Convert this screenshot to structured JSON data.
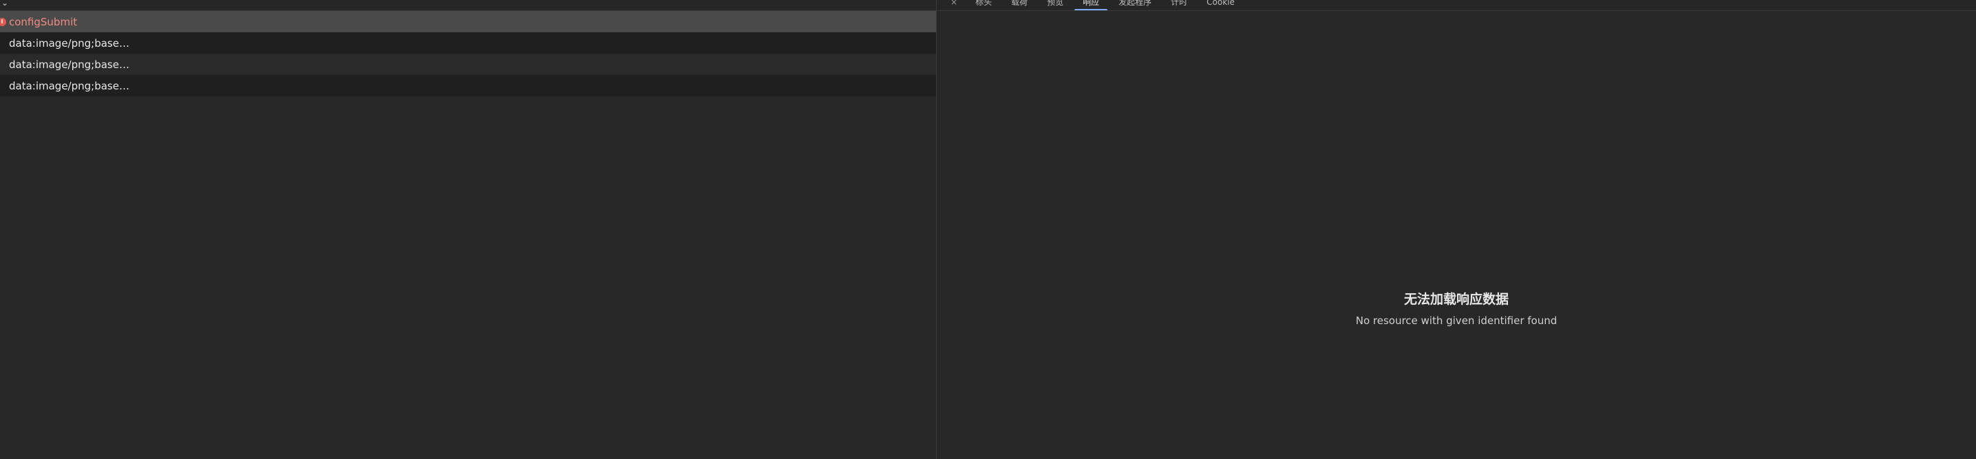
{
  "requests": [
    {
      "name": "configSubmit",
      "status": "error"
    },
    {
      "name": "data:image/png;base…",
      "status": "ok"
    },
    {
      "name": "data:image/png;base…",
      "status": "ok"
    },
    {
      "name": "data:image/png;base…",
      "status": "ok"
    }
  ],
  "detail": {
    "tabs": [
      "×",
      "标头",
      "载荷",
      "预览",
      "响应",
      "发起程序",
      "计时",
      "Cookie"
    ],
    "active_tab_index": 4,
    "empty_title": "无法加载响应数据",
    "empty_message": "No resource with given identifier found"
  },
  "colors": {
    "error": "#f28b82",
    "active_tab_indicator": "#7cacf8",
    "selected_row": "#4a4a4a"
  }
}
